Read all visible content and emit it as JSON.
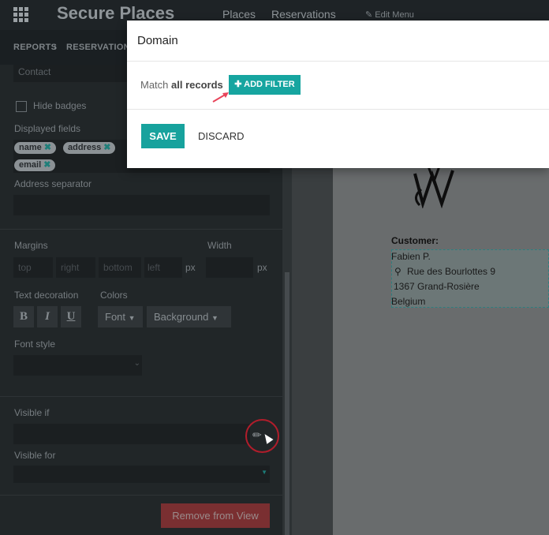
{
  "navbar": {
    "app_title": "Secure Places",
    "items": [
      "Places",
      "Reservations"
    ],
    "edit_menu": "Edit Menu"
  },
  "breadcrumb": [
    "REPORTS",
    "RESERVATIONS"
  ],
  "sidebar": {
    "contact_value": "Contact",
    "hide_badges_label": "Hide badges",
    "displayed_fields_label": "Displayed fields",
    "displayed_fields": [
      "name",
      "address",
      "email"
    ],
    "address_separator_label": "Address separator",
    "margins_label": "Margins",
    "width_label": "Width",
    "margin_placeholders": [
      "top",
      "right",
      "bottom",
      "left"
    ],
    "margin_unit": "px",
    "width_unit": "px",
    "text_decoration_label": "Text decoration",
    "colors_label": "Colors",
    "decoration_buttons": [
      "B",
      "I",
      "U"
    ],
    "color_buttons": [
      "Font",
      "Background"
    ],
    "font_style_label": "Font style",
    "visible_if_label": "Visible if",
    "visible_for_label": "Visible for",
    "remove_button": "Remove from View"
  },
  "report": {
    "customer_label": "Customer:",
    "address_lines": [
      "Fabien P.",
      "Rue des Bourlottes 9",
      "1367 Grand-Rosière",
      "Belgium"
    ]
  },
  "modal": {
    "title": "Domain",
    "match_prefix": "Match",
    "match_bold": "all records",
    "add_filter": "ADD FILTER",
    "save": "SAVE",
    "discard": "DISCARD"
  },
  "colors": {
    "accent": "#17a29d",
    "danger": "#7a2f31",
    "highlight_circle": "#b01d2b"
  }
}
